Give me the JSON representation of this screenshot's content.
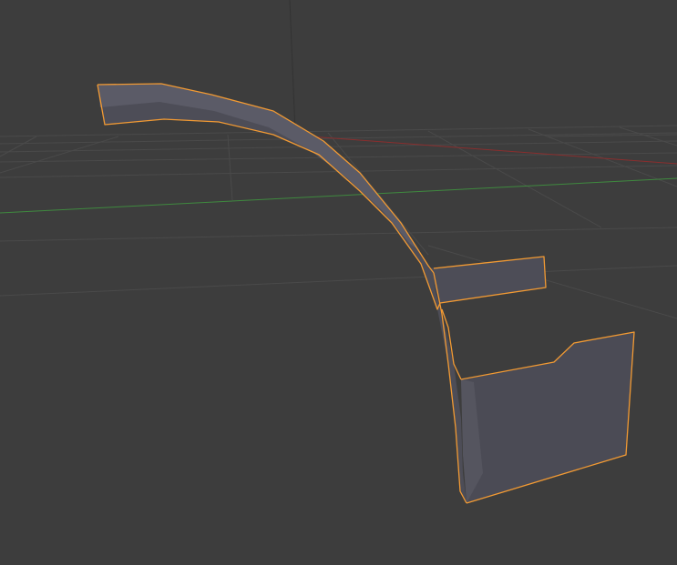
{
  "viewport": {
    "background_color": "#3d3d3d",
    "view": "perspective",
    "grid_color": "#4a4a4a",
    "x_axis_color": "#8a2e2e",
    "y_axis_color": "#3f8a3f",
    "z_axis_color": "#4a4a4a"
  },
  "selected_object": {
    "mode": "object",
    "selected": true,
    "outline_color": "#f29a33",
    "face_color": "#4d4d57",
    "face_shade_light": "#5f5f6b",
    "face_shade_dark": "#45454e"
  }
}
